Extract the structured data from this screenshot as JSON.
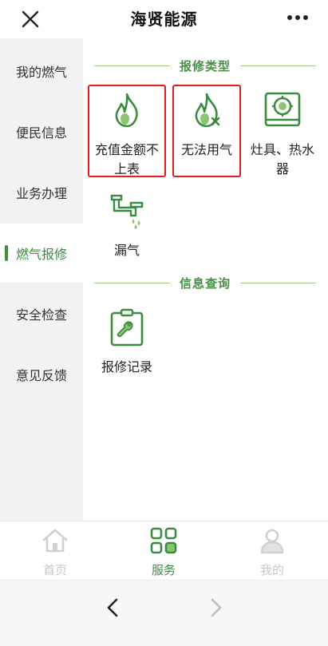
{
  "header": {
    "title": "海贤能源",
    "close_icon": "close-icon",
    "more_icon": "more-dots-icon"
  },
  "sidebar": {
    "items": [
      {
        "label": "我的燃气",
        "active": false
      },
      {
        "label": "便民信息",
        "active": false
      },
      {
        "label": "业务办理",
        "active": false
      },
      {
        "label": "燃气报修",
        "active": true
      },
      {
        "label": "安全检查",
        "active": false
      },
      {
        "label": "意见反馈",
        "active": false
      }
    ]
  },
  "main": {
    "repair_section": {
      "title": "报修类型",
      "tiles": [
        {
          "label": "充值金额不上表",
          "icon": "flame-icon",
          "highlighted": true
        },
        {
          "label": "无法用气",
          "icon": "flame-x-icon",
          "highlighted": true
        },
        {
          "label": "灶具、热水器",
          "icon": "stove-icon",
          "highlighted": false
        },
        {
          "label": "漏气",
          "icon": "pipe-leak-icon",
          "highlighted": false
        }
      ]
    },
    "info_section": {
      "title": "信息查询",
      "tiles": [
        {
          "label": "报修记录",
          "icon": "repair-record-icon"
        }
      ]
    }
  },
  "bottom_nav": {
    "items": [
      {
        "label": "首页",
        "icon": "home-icon",
        "active": false
      },
      {
        "label": "服务",
        "icon": "grid-icon",
        "active": true
      },
      {
        "label": "我的",
        "icon": "user-icon",
        "active": false
      }
    ]
  },
  "browser": {
    "back_icon": "chevron-left-icon",
    "forward_icon": "chevron-right-icon"
  },
  "colors": {
    "accent": "#3a8c3f",
    "highlight_border": "#e02020",
    "section_line": "#9fcf7f"
  }
}
